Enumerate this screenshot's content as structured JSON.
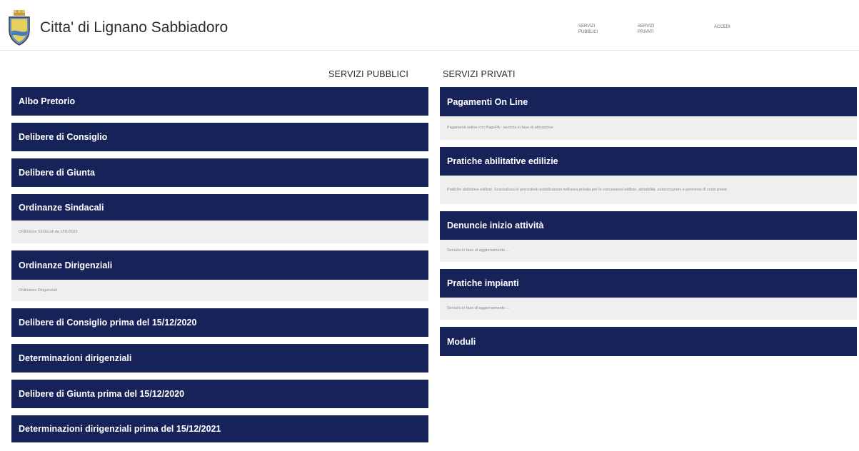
{
  "header": {
    "site_title": "Citta' di Lignano Sabbiadoro",
    "nav": [
      {
        "label": "SERVIZI PUBBLICI"
      },
      {
        "label": "SERVIZI PRIVATI"
      },
      {
        "label": "ACCEDI"
      }
    ]
  },
  "colors": {
    "bar": "#172358",
    "description_background": "#efefef"
  },
  "public_services": {
    "title": "SERVIZI PUBBLICI",
    "items": [
      {
        "label": "Albo Pretorio"
      },
      {
        "label": "Delibere di Consiglio"
      },
      {
        "label": "Delibere di Giunta"
      },
      {
        "label": "Ordinanze Sindacali",
        "description": "Ordinanze Sindacali da 1/01/2021"
      },
      {
        "label": "Ordinanze Dirigenziali",
        "description": "Ordinanze Dirigenziali"
      },
      {
        "label": "Delibere di Consiglio prima del 15/12/2020"
      },
      {
        "label": "Determinazioni dirigenziali"
      },
      {
        "label": "Delibere di Giunta prima del 15/12/2020"
      },
      {
        "label": "Determinazioni dirigenziali prima del 15/12/2021"
      }
    ]
  },
  "private_services": {
    "title": "SERVIZI PRIVATI",
    "items": [
      {
        "label": "Pagamenti On Line",
        "description": "Pagamenti online con PagoPA - servizio in fase di attivazione"
      },
      {
        "label": "Pratiche abilitative edilizie",
        "description": "Pratiche abilitative edilizie. Scarica/usa le precedenti pubblicazioni nell'area privata per le concessioni edilizie, abitabilità, autorizzazioni e permessi di costruzione"
      },
      {
        "label": "Denuncie inizio attività",
        "description": "Servizio in fase di aggiornamento ..."
      },
      {
        "label": "Pratiche impianti",
        "description": "Servizio in fase di aggiornamento ..."
      },
      {
        "label": "Moduli"
      }
    ]
  }
}
